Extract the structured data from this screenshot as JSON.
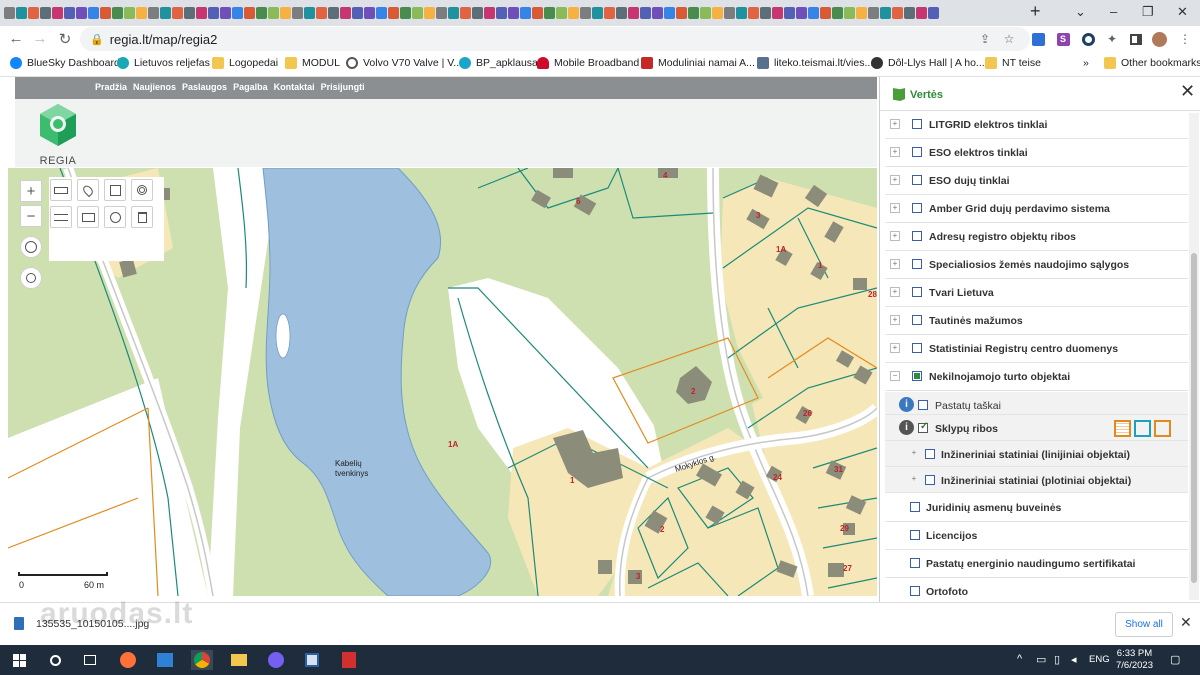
{
  "browser": {
    "url": "regia.lt/map/regia2",
    "new_tab": "+",
    "window_controls": [
      "⌄",
      "–",
      "❐",
      "✕"
    ]
  },
  "bookmarks": {
    "items": [
      {
        "label": "BlueSky Dashboard",
        "icon": "bluesky-icon",
        "color": "#1185fe"
      },
      {
        "label": "Lietuvos reljefas",
        "icon": "globe-icon",
        "color": "#19a8b8"
      },
      {
        "label": "Logopedai",
        "icon": "folder-icon",
        "color": "#f3c650"
      },
      {
        "label": "MODUL",
        "icon": "folder-icon",
        "color": "#f3c650"
      },
      {
        "label": "Volvo V70 Valve | V...",
        "icon": "volvo-icon",
        "color": "#555555"
      },
      {
        "label": "BP_apklausa",
        "icon": "survey-icon",
        "color": "#1ca4c9"
      },
      {
        "label": "Mobile Broadband",
        "icon": "huawei-icon",
        "color": "#cf0a2c"
      },
      {
        "label": "Moduliniai namai A...",
        "icon": "ka-icon",
        "color": "#c62828"
      },
      {
        "label": "liteko.teismai.lt/vies...",
        "icon": "court-icon",
        "color": "#5b6f8f"
      },
      {
        "label": "Dôl-Llys Hall | A ho...",
        "icon": "wordpress-icon",
        "color": "#333333"
      },
      {
        "label": "NT teise",
        "icon": "folder-icon",
        "color": "#f3c650"
      }
    ],
    "more": "»",
    "other_label": "Other bookmarks"
  },
  "site": {
    "nav": [
      "Pradžia",
      "Naujienos",
      "Paslaugos",
      "Pagalba",
      "Kontaktai",
      "Prisijungti"
    ],
    "logo_text": "REGIA"
  },
  "map": {
    "labels": {
      "lake_line1": "Kabelių",
      "lake_line2": "tvenkinys",
      "street": "Mokyklos g.",
      "parcel_1a_left": "1A",
      "parcel_1a_right": "1A",
      "parcel_1": "1",
      "parcel_1b": "1",
      "parcel_2": "2",
      "parcel_2b": "2",
      "parcel_3": "3",
      "parcel_3b": "3",
      "parcel_4": "4",
      "parcel_6": "6",
      "parcel_24": "24",
      "parcel_26": "26",
      "parcel_27": "27",
      "parcel_28": "28",
      "parcel_29": "29",
      "parcel_31": "31"
    },
    "scale": {
      "start": "0",
      "end": "60 m"
    },
    "tools": {
      "zoom_in": "+",
      "zoom_out": "−"
    }
  },
  "layers": {
    "title": "Vertės",
    "close": "✕",
    "rows": [
      {
        "label": "LITGRID elektros tinklai",
        "checked": false,
        "expandable": true
      },
      {
        "label": "ESO elektros tinklai",
        "checked": false,
        "expandable": true
      },
      {
        "label": "ESO dujų tinklai",
        "checked": false,
        "expandable": true
      },
      {
        "label": "Amber Grid dujų perdavimo sistema",
        "checked": false,
        "expandable": true
      },
      {
        "label": "Adresų registro objektų ribos",
        "checked": false,
        "expandable": true
      },
      {
        "label": "Specialiosios žemės naudojimo sąlygos",
        "checked": false,
        "expandable": true
      },
      {
        "label": "Tvari Lietuva",
        "checked": false,
        "expandable": true
      },
      {
        "label": "Tautinės mažumos",
        "checked": false,
        "expandable": true
      },
      {
        "label": "Statistiniai Registrų centro duomenys",
        "checked": false,
        "expandable": true
      },
      {
        "label": "Nekilnojamojo turto objektai",
        "checked": true,
        "expandable": true,
        "expanded": true
      },
      {
        "label": "Pastatų taškai",
        "checked": false,
        "sub": true,
        "info": true
      },
      {
        "label": "Sklypų ribos",
        "checked": true,
        "sub": true,
        "info": true,
        "active": true
      },
      {
        "label": "Inžineriniai statiniai (linijiniai objektai)",
        "checked": false,
        "sub": true,
        "expandable": true
      },
      {
        "label": "Inžineriniai statiniai (plotiniai objektai)",
        "checked": false,
        "sub": true,
        "expandable": true
      },
      {
        "label": "Juridinių asmenų buveinės",
        "checked": false
      },
      {
        "label": "Licencijos",
        "checked": false
      },
      {
        "label": "Pastatų energinio naudingumo sertifikatai",
        "checked": false
      },
      {
        "label": "Ortofoto",
        "checked": false
      }
    ],
    "info_glyph": "i"
  },
  "downloads": {
    "file": "135535_10150105....jpg",
    "show_all": "Show all",
    "close": "✕",
    "watermark": "aruodas.lt"
  },
  "taskbar": {
    "time": "6:33 PM",
    "date": "7/6/2023",
    "lang": "ENG"
  },
  "colors": {
    "water": "#9ebfdd",
    "grass": "#cfe0b0",
    "parcel_fill": "#f6e7b8",
    "parcel_line": "#1b8a7a",
    "building": "#8c8c7a",
    "road": "#c8c8c8",
    "label_red": "#c0242a",
    "accent_green": "#2e8b3d"
  }
}
